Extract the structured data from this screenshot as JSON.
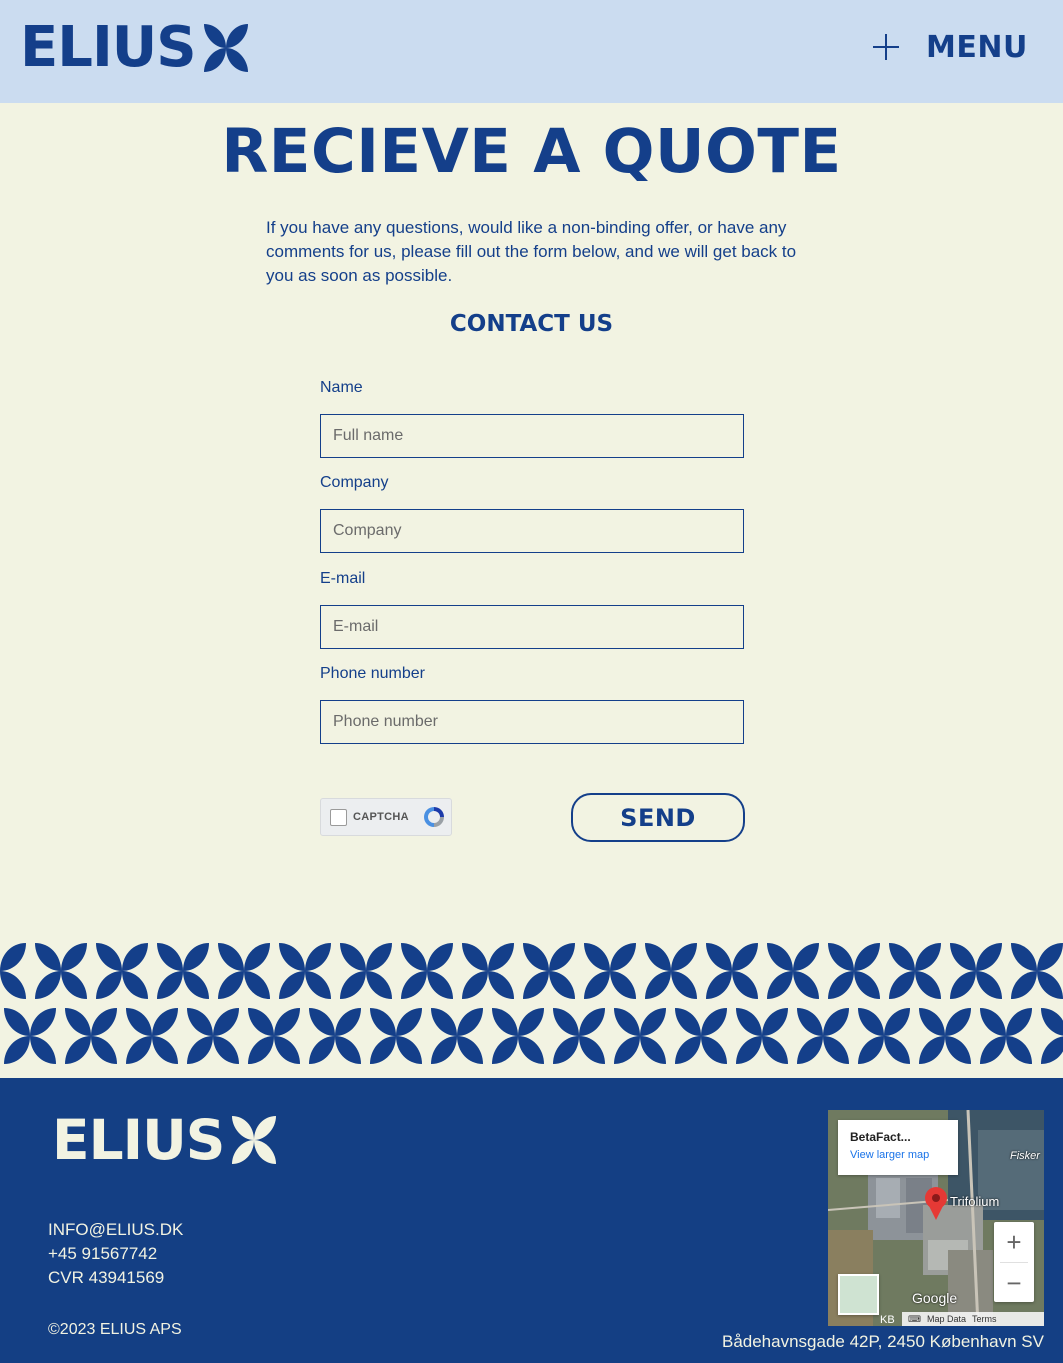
{
  "header": {
    "logo_text": "ELIUS",
    "menu_label": "MENU"
  },
  "main": {
    "title": "RECIEVE A QUOTE",
    "intro": "If you have any questions, would like a non-binding offer, or have any comments for us, please fill out the form below, and we will get back to you as soon as possible.",
    "contact_title": "CONTACT US",
    "form": {
      "fields": [
        {
          "label": "Name",
          "placeholder": "Full name"
        },
        {
          "label": "Company",
          "placeholder": "Company"
        },
        {
          "label": "E-mail",
          "placeholder": "E-mail"
        },
        {
          "label": "Phone number",
          "placeholder": "Phone number"
        }
      ],
      "captcha_label": "CAPTCHA",
      "send_label": "SEND"
    }
  },
  "footer": {
    "logo_text": "ELIUS",
    "email": "INFO@ELIUS.DK",
    "phone": "+45 91567742",
    "cvr": "CVR 43941569",
    "copyright": "©2023 ELIUS APS",
    "address": "Bådehavnsgade 42P, 2450 København SV",
    "map": {
      "place_title": "BetaFact...",
      "larger_map_link": "View larger map",
      "pin_label": "Trifolium",
      "edge_label": "Fisker",
      "google_label": "Google",
      "kb_label": "KB",
      "map_data_label": "Map Data",
      "terms_label": "Terms",
      "zoom_in": "+",
      "zoom_out": "−"
    }
  },
  "colors": {
    "brand_blue": "#143f8a",
    "cream": "#f2f3e2",
    "header_bg": "#cbdcf0"
  }
}
